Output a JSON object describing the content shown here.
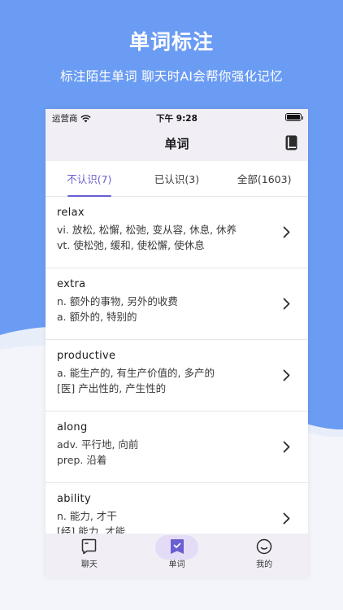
{
  "promo": {
    "title": "单词标注",
    "subtitle": "标注陌生单词  聊天时AI会帮你强化记忆"
  },
  "status_bar": {
    "carrier": "运营商",
    "time": "下午 9:28"
  },
  "nav": {
    "title": "单词",
    "book_icon": "book-icon"
  },
  "tabs": [
    {
      "label": "不认识(7)",
      "active": true
    },
    {
      "label": "已认识(3)",
      "active": false
    },
    {
      "label": "全部(1603)",
      "active": false
    }
  ],
  "words": [
    {
      "word": "relax",
      "defs": [
        "vi. 放松, 松懈, 松弛, 变从容, 休息, 休养",
        "vt. 使松弛, 缓和, 使松懈, 使休息"
      ]
    },
    {
      "word": "extra",
      "defs": [
        "n. 额外的事物, 另外的收费",
        "a. 额外的, 特别的"
      ]
    },
    {
      "word": "productive",
      "defs": [
        "a. 能生产的, 有生产价值的, 多产的",
        "[医] 产出性的, 产生性的"
      ]
    },
    {
      "word": "along",
      "defs": [
        "adv. 平行地, 向前",
        "prep. 沿着"
      ]
    },
    {
      "word": "ability",
      "defs": [
        "n. 能力, 才干",
        "[经] 能力, 才能"
      ]
    }
  ],
  "tab_bar": [
    {
      "label": "聊天",
      "icon": "chat-icon",
      "active": false
    },
    {
      "label": "单词",
      "icon": "bookmark-check-icon",
      "active": true
    },
    {
      "label": "我的",
      "icon": "smile-icon",
      "active": false
    }
  ],
  "colors": {
    "background": "#6b9cf3",
    "accent": "#6a5fd1",
    "bar": "#f1eff5"
  }
}
